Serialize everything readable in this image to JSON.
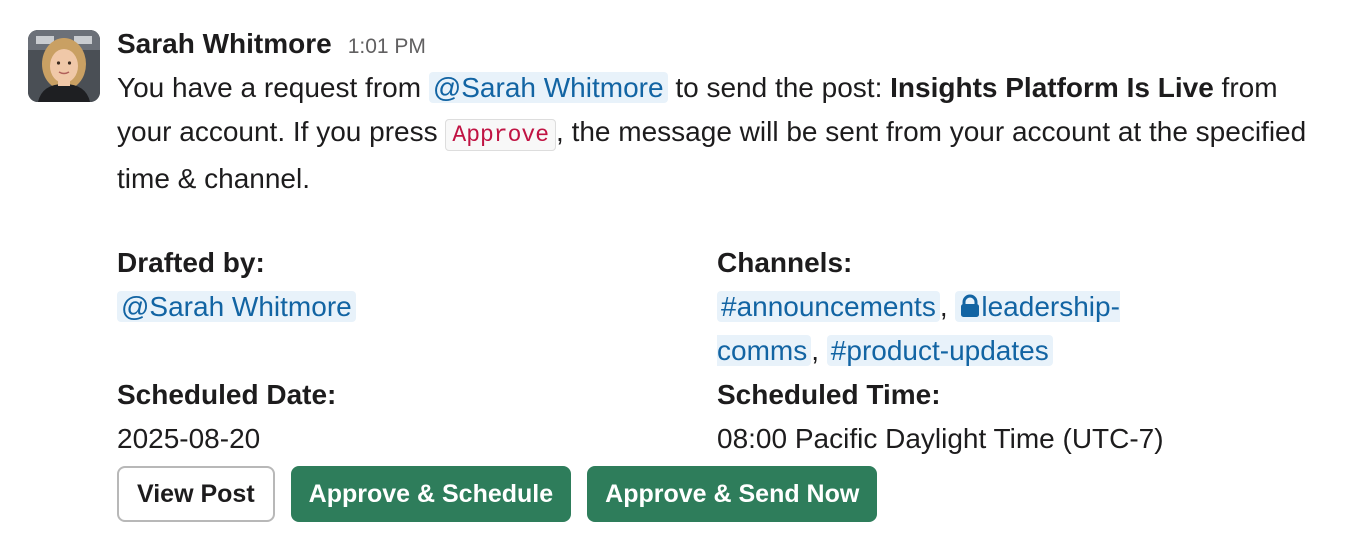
{
  "message": {
    "sender_name": "Sarah Whitmore",
    "timestamp": "1:01 PM",
    "avatar_icon": "user-portrait-icon",
    "body": {
      "part1": "You have a request from ",
      "mention": "@Sarah Whitmore",
      "part2": " to send the post: ",
      "post_title": "Insights Platform Is Live",
      "part3": " from your account. If you press ",
      "code_word": "Approve",
      "part4": ", the message will be sent from your account at the specified time & channel."
    }
  },
  "fields": {
    "drafted_by": {
      "label": "Drafted by:",
      "value": "@Sarah Whitmore"
    },
    "channels": {
      "label": "Channels:",
      "items": [
        "#announcements",
        "leadership-comms",
        "#product-updates"
      ],
      "private_icon": "lock-icon",
      "separator": ", "
    },
    "scheduled_date": {
      "label": "Scheduled Date:",
      "value": "2025-08-20"
    },
    "scheduled_time": {
      "label": "Scheduled Time:",
      "value": "08:00 Pacific Daylight Time (UTC-7)"
    }
  },
  "buttons": {
    "view_post": "View Post",
    "approve_schedule": "Approve & Schedule",
    "approve_send_now": "Approve & Send Now"
  },
  "colors": {
    "mention_bg": "#e8f2fa",
    "mention_text": "#1264a3",
    "primary_button": "#2e7d5b",
    "code_text": "#c01343"
  }
}
